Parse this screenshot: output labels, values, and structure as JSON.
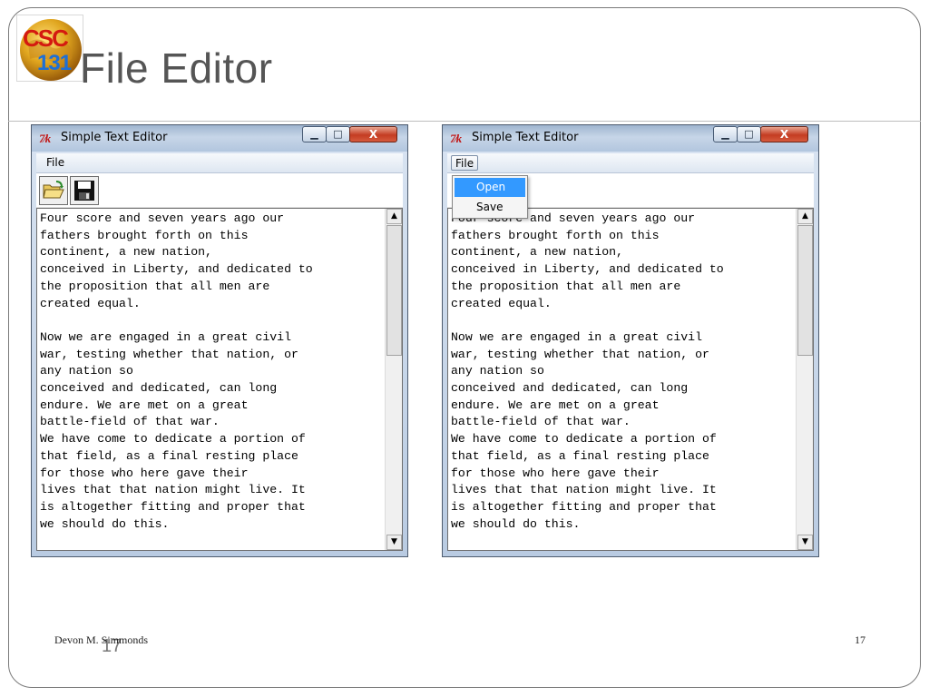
{
  "slide": {
    "title": "File Editor",
    "logo_text": "CSC 131",
    "footer_author": "Devon M. Simmonds",
    "footer_page_left": "17",
    "footer_page_right": "17"
  },
  "windows": [
    {
      "title": "Simple Text Editor",
      "icon": "tk-feather-icon",
      "menu": [
        "File"
      ],
      "toolbar": [
        "open-folder-icon",
        "floppy-save-icon"
      ],
      "minimize_glyph": "▁",
      "maximize_glyph": "□",
      "close_glyph": "X",
      "text": "Four score and seven years ago our\nfathers brought forth on this\ncontinent, a new nation,\nconceived in Liberty, and dedicated to\nthe proposition that all men are\ncreated equal.\n\nNow we are engaged in a great civil\nwar, testing whether that nation, or\nany nation so\nconceived and dedicated, can long\nendure. We are met on a great\nbattle-field of that war.\nWe have come to dedicate a portion of\nthat field, as a final resting place\nfor those who here gave their\nlives that that nation might live. It\nis altogether fitting and proper that\nwe should do this."
    },
    {
      "title": "Simple Text Editor",
      "icon": "tk-feather-icon",
      "menu": [
        "File"
      ],
      "minimize_glyph": "▁",
      "maximize_glyph": "□",
      "close_glyph": "X",
      "dropdown": [
        "Open",
        "Save"
      ],
      "dropdown_selected": "Open",
      "text": "Four score and seven years ago our\nfathers brought forth on this\ncontinent, a new nation,\nconceived in Liberty, and dedicated to\nthe proposition that all men are\ncreated equal.\n\nNow we are engaged in a great civil\nwar, testing whether that nation, or\nany nation so\nconceived and dedicated, can long\nendure. We are met on a great\nbattle-field of that war.\nWe have come to dedicate a portion of\nthat field, as a final resting place\nfor those who here gave their\nlives that that nation might live. It\nis altogether fitting and proper that\nwe should do this."
    }
  ],
  "colors": {
    "title_gray": "#555555",
    "menu_highlight": "#3399ff",
    "close_button_red": "#c43c22"
  }
}
